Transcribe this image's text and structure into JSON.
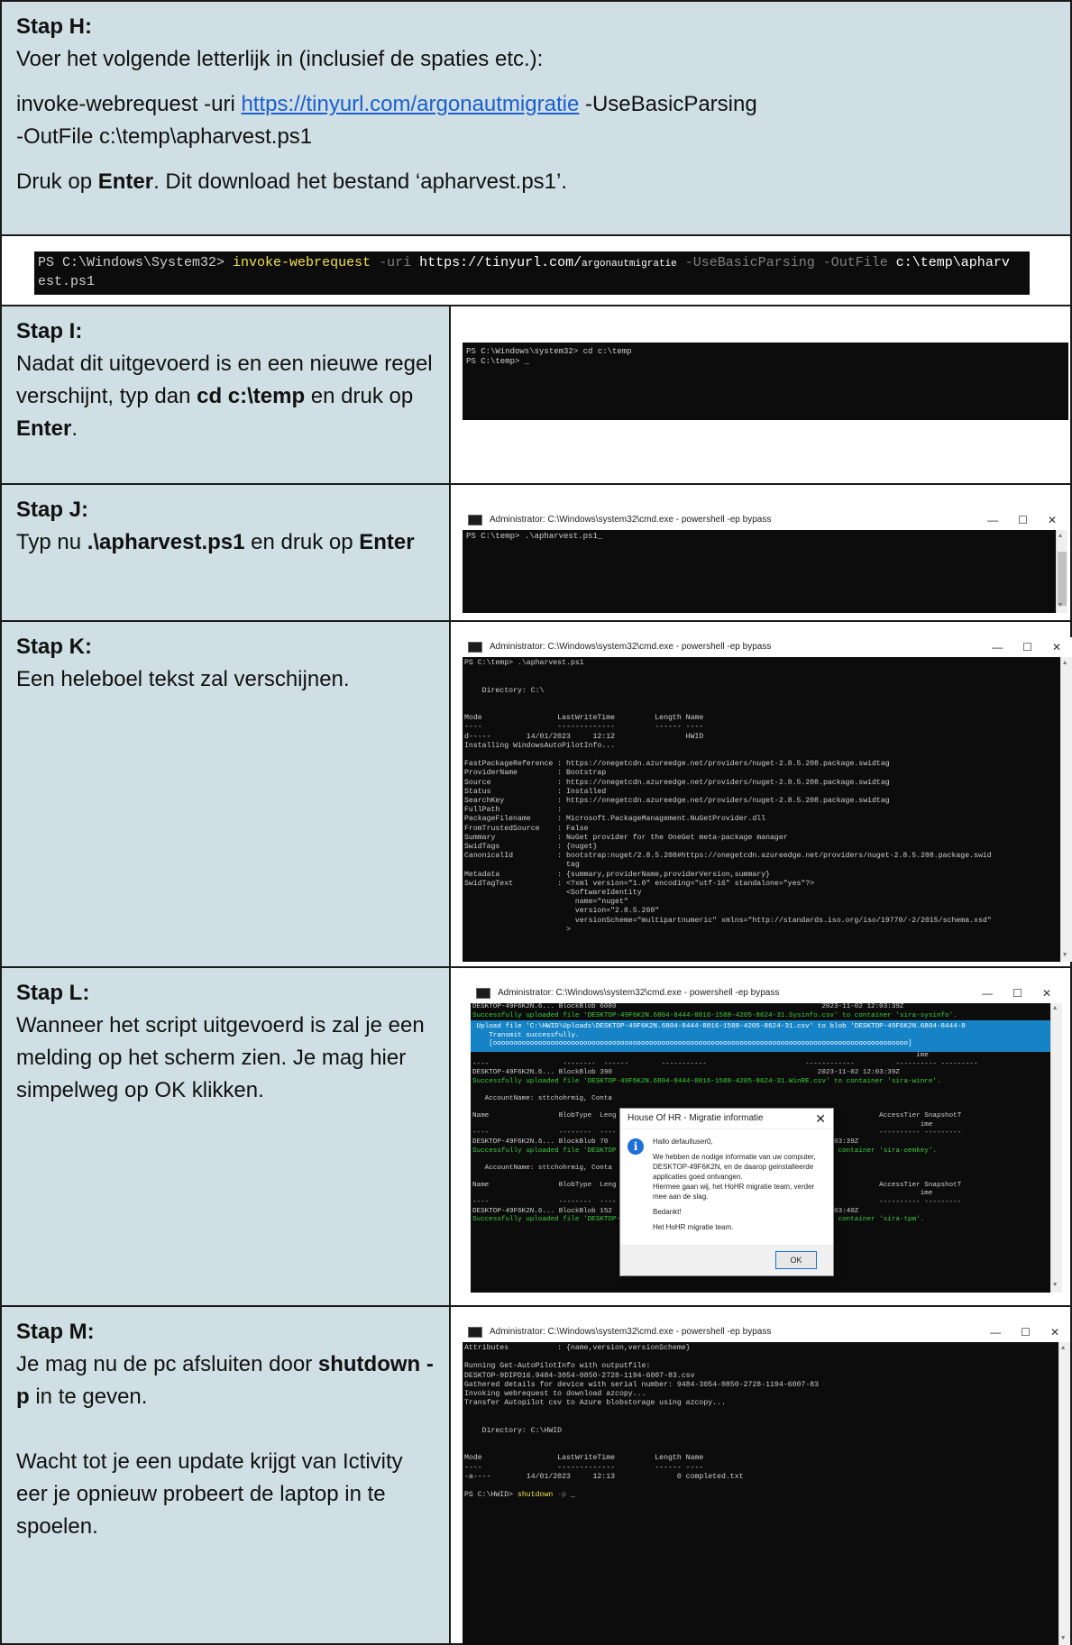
{
  "stap_h": {
    "title": "Stap H:",
    "line1": "Voer het volgende letterlijk in (inclusief de spaties etc.):",
    "cmd_prefix": "invoke-webrequest -uri ",
    "cmd_link": "https://tinyurl.com/argonautmigratie",
    "cmd_suffix": " -UseBasicParsing",
    "cmd_line2": "-OutFile c:\\temp\\apharvest.ps1",
    "press_prefix": "Druk op ",
    "press_key": "Enter",
    "press_suffix": ". Dit download het bestand ‘apharvest.ps1’."
  },
  "screenshot_h": {
    "prompt": "PS C:\\Windows\\System32> ",
    "cmd": "invoke-webrequest",
    "arg_uri": " -uri ",
    "url": "https://tinyurl.com/",
    "url_tail": "argonautmigratie",
    "arg_basic": " -UseBasicParsing -OutFile ",
    "path": "c:\\temp\\apharv",
    "line2": "est.ps1"
  },
  "stap_i": {
    "title": "Stap I:",
    "text1": "Nadat dit uitgevoerd is en een nieuwe regel verschijnt, typ dan ",
    "bold": "cd c:\\temp",
    "text2": " en druk op ",
    "key": "Enter",
    "text3": ".",
    "term_line1": "PS C:\\Windows\\system32> cd c:\\temp",
    "term_line2": "PS C:\\temp> _"
  },
  "stap_j": {
    "title": "Stap J:",
    "text1": "Typ nu ",
    "bold": ".\\apharvest.ps1",
    "text2": " en druk op ",
    "key": "Enter",
    "win_title": "Administrator: C:\\Windows\\system32\\cmd.exe - powershell  -ep bypass",
    "term_line1": "PS C:\\temp> .\\apharvest.ps1_"
  },
  "stap_k": {
    "title": "Stap K:",
    "text": "Een heleboel tekst zal verschijnen.",
    "win_title": "Administrator: C:\\Windows\\system32\\cmd.exe - powershell  -ep bypass",
    "term_text": "PS C:\\temp> .\\apharvest.ps1\n\n\n    Directory: C:\\\n\n\nMode                 LastWriteTime         Length Name\n----                 -------------         ------ ----\nd-----        14/01/2023     12:12                HWID\nInstalling WindowsAutoPilotInfo...\n\nFastPackageReference : https://onegetcdn.azureedge.net/providers/nuget-2.8.5.208.package.swidtag\nProviderName         : Bootstrap\nSource               : https://onegetcdn.azureedge.net/providers/nuget-2.8.5.208.package.swidtag\nStatus               : Installed\nSearchKey            : https://onegetcdn.azureedge.net/providers/nuget-2.8.5.208.package.swidtag\nFullPath             :\nPackageFilename      : Microsoft.PackageManagement.NuGetProvider.dll\nFromTrustedSource    : False\nSummary              : NuGet provider for the OneGet meta-package manager\nSwidTags             : {nuget}\nCanonicalId          : bootstrap:nuget/2.8.5.208#https://onegetcdn.azureedge.net/providers/nuget-2.8.5.208.package.swid\n                       tag\nMetadata             : {summary,providerName,providerVersion,summary}\nSwidTagText          : <?xml version=\"1.0\" encoding=\"utf-16\" standalone=\"yes\"?>\n                       <SoftwareIdentity\n                         name=\"nuget\"\n                         version=\"2.8.5.208\"\n                         versionScheme=\"multipartnumeric\" xmlns=\"http://standards.iso.org/iso/19770/-2/2015/schema.xsd\"\n                       >"
  },
  "stap_l": {
    "title": "Stap L:",
    "text": "Wanneer het script uitgevoerd is zal je een melding op het scherm zien. Je mag hier simpelweg op OK klikken.",
    "win_title": "Administrator: C:\\Windows\\system32\\cmd.exe - powershell  -ep bypass",
    "l1": "DESKTOP-49F6K2N.6... BlockBlob 6080                                                  2023-11-02 12:03:39Z",
    "l2": "Successfully uploaded file 'DESKTOP-49F6K2N.6804-8444-8816-1588-4205-8624-31.Sysinfo.csv' to container 'sira-sysinfo'.",
    "band1": " Upload file 'C:\\HWID\\Uploads\\DESKTOP-49F6K2N.6804-8444-8816-1588-4205-8624-31.csv' to blob 'DESKTOP-49F6K2N.6804-8444-8",
    "band2": "    Transmit successfully.",
    "band3": "    [ooooooooooooooooooooooooooooooooooooooooooooooooooooooooooooooooooooooooooooooooooooooooooooooooooooo]",
    "l3": "                                                                                                            ime",
    "l4": "----                  --------  ------        -----------                        ------------          ---------- ---------",
    "l5": "DESKTOP-49F6K2N.6... BlockBlob 390                                                  2023-11-02 12:03:39Z",
    "l6": "Successfully uploaded file 'DESKTOP-49F6K2N.6804-8444-8816-1588-4205-8624-31.WinRE.csv' to container 'sira-winre'.",
    "l7": "   AccountName: sttchohrmig, Conta",
    "l8": "Name                 BlobType  Leng                                               fied             AccessTier SnapshotT",
    "l9": "                                                                                                             ime",
    "l10": "----                 --------  ----                                                                ---------- ---------",
    "l11": "DESKTOP-49F6K2N.6... BlockBlob 70                                                 02 12:03:39Z",
    "l12": "Successfully uploaded file 'DESKTOP                                                v' to container 'sira-oemkey'.",
    "l13": "   AccountName: sttchohrmig, Conta",
    "l14": "Name                 BlobType  Leng                                               fied             AccessTier SnapshotT",
    "l15": "                                                                                                             ime",
    "l16": "----                 --------  ----                                                                ---------- ---------",
    "l17": "DESKTOP-49F6K2N.6... BlockBlob 152                                                02 12:03:40Z",
    "l18": "Successfully uploaded file 'DESKTOP-49F6K2N.6804-8444-8816-1588-4205-8624-31.Tpm.csv' to container 'sira-tpm'.",
    "dialog_title": "House Of HR - Migratie informatie",
    "dialog_greeting": "Hallo defaultuser0,",
    "dialog_p1": "We hebben de nodige informatie van uw computer, DESKTOP-49F6K2N, en de daarop geinstalleerde applicaties goed ontvangen.",
    "dialog_p2": "Hiermee gaan wij, het HoHR migratie team, verder mee aan de slag.",
    "dialog_thanks": "Bedankt!",
    "dialog_sign": "Het HoHR migratie team.",
    "dialog_ok": "OK"
  },
  "stap_m": {
    "title": "Stap M:",
    "text1": "Je mag nu de pc afsluiten door ",
    "bold": "shutdown -p",
    "text2": " in te geven.",
    "para2": "Wacht tot je een update krijgt van Ictivity eer je opnieuw probeert de laptop in te spoelen.",
    "win_title": "Administrator: C:\\Windows\\system32\\cmd.exe - powershell  -ep bypass",
    "term_text": "Attributes           : {name,version,versionScheme}\n\nRunning Get-AutoPilotInfo with outputfile:\nDESKTOP-9DIPD16.9484-3054-0850-2728-1194-6007-83.csv\nGathered details for device with serial number: 9484-3054-0850-2728-1194-6007-83\nInvoking webrequest to download azcopy...\nTransfer Autopilot csv to Azure blobstorage using azcopy...\n\n\n    Directory: C:\\HWID\n\n\nMode                 LastWriteTime         Length Name\n----                 -------------         ------ ----\n-a----        14/01/2023     12:13              0 completed.txt\n\n",
    "prompt": "PS C:\\HWID> ",
    "cmd": "shutdown",
    "arg": " -p ",
    "cursor": "_"
  }
}
